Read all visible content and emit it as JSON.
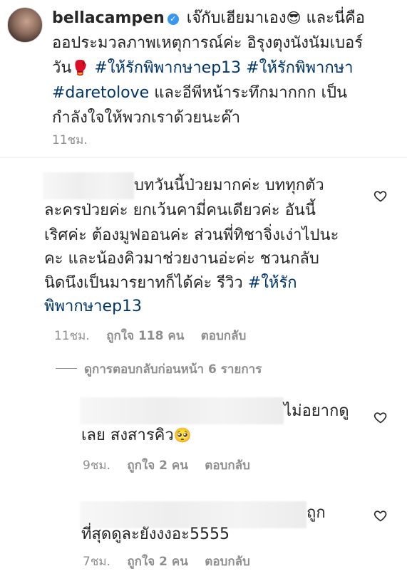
{
  "post": {
    "username": "bellacampen",
    "text_line1": "เจ๊กับเฮียมาเอง",
    "text_line1b": "และนี่คือ",
    "text_line2": "ออประมวลภาพเหตุการณ์ค่ะ อิรุงตุงนังนัมเบอร์",
    "text_line3a": "วัน",
    "hashtag1": "#ให้รักพิพากษาep13",
    "hashtag2": "#ให้รักพิพากษา",
    "hashtag3": "#daretolove",
    "text_line4b": "และอีพีหน้าระทึกมากกก เป็น",
    "text_line5": "กำลังใจให้พวกเราด้วยนะค๊า",
    "time": "11ชม."
  },
  "comments": [
    {
      "lines": [
        "บทวันนี้ป่วยมากค่ะ บททุกตัว",
        "ละครป่วยค่ะ ยกเว้นคามี่คนเดียวค่ะ อันนี้",
        "เริศค่ะ ต้องมูฟออนค่ะ ส่วนพี่ทิชาจิ่งเง่าไปนะ",
        "คะ และน้องคิวมาช่วยงานอ่ะค่ะ ชวนกลับ",
        "นิดนึงเป็นมารยาทก็ได้ค่ะ รีวิว"
      ],
      "hashtag": "#ให้รัก",
      "hashtag_cont": "พิพากษาep13",
      "time": "11ชม.",
      "likes": "ถูกใจ 118 คน",
      "reply": "ตอบกลับ"
    },
    {
      "line1": "ไม่อยากดู",
      "line2": "เลย สงสารคิว",
      "time": "9ชม.",
      "likes": "ถูกใจ 2 คน",
      "reply": "ตอบกลับ"
    },
    {
      "line1": "ถูก",
      "line2": "ที่สุดดูละยังงงอะ5555",
      "time": "7ชม.",
      "likes": "ถูกใจ 2 คน",
      "reply": "ตอบกลับ"
    }
  ],
  "view_replies": "ดูการตอบกลับก่อนหน้า 6 รายการ",
  "icons": {
    "verified": "verified-badge-icon",
    "heart": "heart-outline-icon",
    "emoji_sunglasses": "😎",
    "emoji_boxing": "🥊",
    "emoji_pleading": "🥺"
  }
}
